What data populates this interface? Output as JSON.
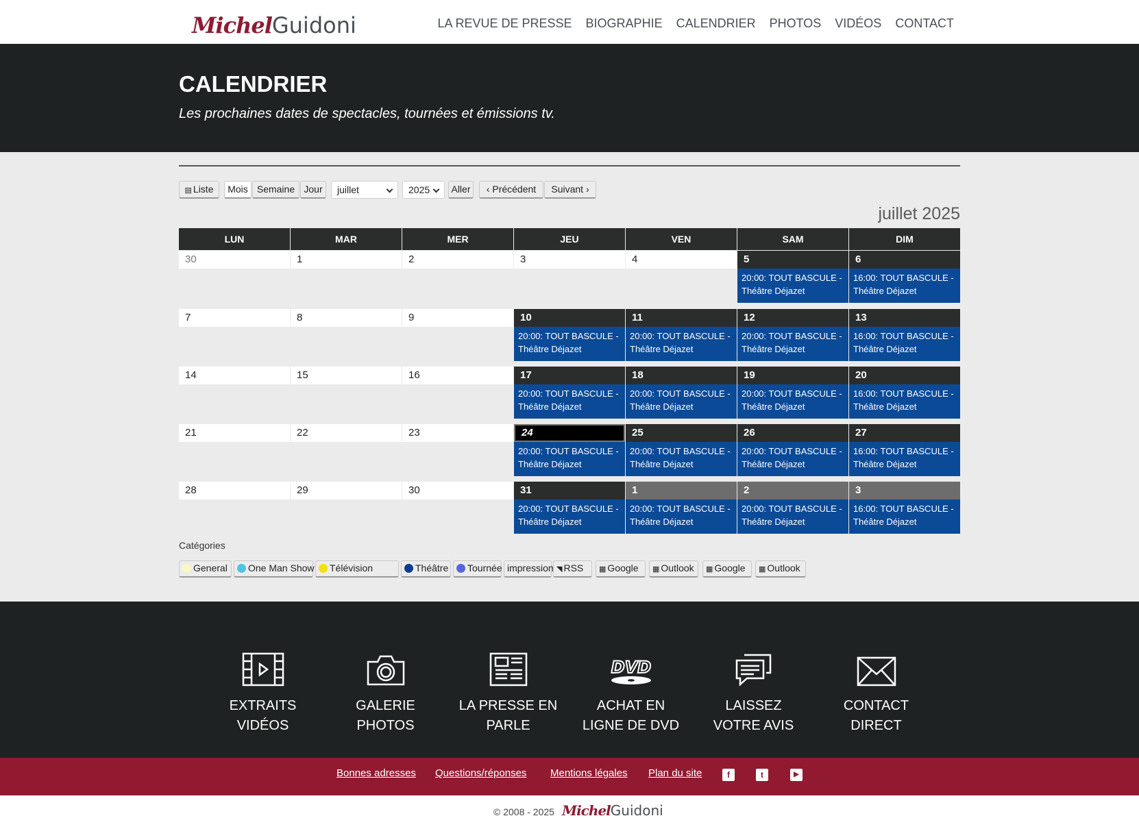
{
  "site": {
    "logo_first": "Michel",
    "logo_last": "Guidoni"
  },
  "nav": [
    "LA REVUE DE PRESSE",
    "BIOGRAPHIE",
    "CALENDRIER",
    "PHOTOS",
    "VIDÉOS",
    "CONTACT"
  ],
  "banner": {
    "title": "CALENDRIER",
    "subtitle": "Les prochaines dates de spectacles, tournées et émissions tv."
  },
  "toolbar": {
    "list": "Liste",
    "month": "Mois",
    "week": "Semaine",
    "day": "Jour",
    "month_select": "juillet",
    "year_select": "2025",
    "go": "Aller",
    "prev": "Précédent",
    "next": "Suivant"
  },
  "calendar": {
    "title": "juillet 2025",
    "weekdays": [
      "LUN",
      "MAR",
      "MER",
      "JEU",
      "VEN",
      "SAM",
      "DIM"
    ],
    "weeks": [
      [
        {
          "d": "30",
          "other": true
        },
        {
          "d": "1"
        },
        {
          "d": "2"
        },
        {
          "d": "3"
        },
        {
          "d": "4"
        },
        {
          "d": "5",
          "ev": "20:00: TOUT BASCULE - Théâtre Déjazet"
        },
        {
          "d": "6",
          "ev": "16:00: TOUT BASCULE - Théâtre Déjazet"
        }
      ],
      [
        {
          "d": "7"
        },
        {
          "d": "8"
        },
        {
          "d": "9"
        },
        {
          "d": "10",
          "ev": "20:00: TOUT BASCULE - Théâtre Déjazet"
        },
        {
          "d": "11",
          "ev": "20:00: TOUT BASCULE - Théâtre Déjazet"
        },
        {
          "d": "12",
          "ev": "20:00: TOUT BASCULE - Théâtre Déjazet"
        },
        {
          "d": "13",
          "ev": "16:00: TOUT BASCULE - Théâtre Déjazet"
        }
      ],
      [
        {
          "d": "14"
        },
        {
          "d": "15"
        },
        {
          "d": "16"
        },
        {
          "d": "17",
          "ev": "20:00: TOUT BASCULE - Théâtre Déjazet"
        },
        {
          "d": "18",
          "ev": "20:00: TOUT BASCULE - Théâtre Déjazet"
        },
        {
          "d": "19",
          "ev": "20:00: TOUT BASCULE - Théâtre Déjazet"
        },
        {
          "d": "20",
          "ev": "16:00: TOUT BASCULE - Théâtre Déjazet"
        }
      ],
      [
        {
          "d": "21"
        },
        {
          "d": "22"
        },
        {
          "d": "23"
        },
        {
          "d": "24",
          "today": true,
          "ev": "20:00: TOUT BASCULE - Théâtre Déjazet"
        },
        {
          "d": "25",
          "ev": "20:00: TOUT BASCULE - Théâtre Déjazet"
        },
        {
          "d": "26",
          "ev": "20:00: TOUT BASCULE - Théâtre Déjazet"
        },
        {
          "d": "27",
          "ev": "16:00: TOUT BASCULE - Théâtre Déjazet"
        }
      ],
      [
        {
          "d": "28"
        },
        {
          "d": "29"
        },
        {
          "d": "30"
        },
        {
          "d": "31",
          "ev": "20:00: TOUT BASCULE - Théâtre Déjazet"
        },
        {
          "d": "1",
          "next": true,
          "ev": "20:00: TOUT BASCULE - Théâtre Déjazet"
        },
        {
          "d": "2",
          "next": true,
          "ev": "20:00: TOUT BASCULE - Théâtre Déjazet"
        },
        {
          "d": "3",
          "next": true,
          "ev": "16:00: TOUT BASCULE - Théâtre Déjazet"
        }
      ]
    ]
  },
  "categories": {
    "label": "Catégories",
    "items": [
      {
        "label": "General",
        "color": "#fbf6c4"
      },
      {
        "label": "One Man Show",
        "color": "#4fc3e4"
      },
      {
        "label": "Télévision",
        "color": "#f2e20a"
      },
      {
        "label": "Théâtre",
        "color": "#0b3d8f"
      },
      {
        "label": "Tournée",
        "color": "#5566dd"
      },
      {
        "label": "impression"
      },
      {
        "label": "RSS",
        "icon": "rss-icon"
      },
      {
        "label": "Google",
        "icon": "calendar-icon"
      },
      {
        "label": "Outlook",
        "icon": "calendar-icon"
      },
      {
        "label": "Google",
        "icon": "calendar-icon"
      },
      {
        "label": "Outlook",
        "icon": "calendar-icon"
      }
    ]
  },
  "footer_links": [
    {
      "l1": "EXTRAITS",
      "l2": "VIDÉOS",
      "icon": "film-icon"
    },
    {
      "l1": "GALERIE",
      "l2": "PHOTOS",
      "icon": "camera-icon"
    },
    {
      "l1": "LA PRESSE EN",
      "l2": "PARLE",
      "icon": "newspaper-icon"
    },
    {
      "l1": "ACHAT EN",
      "l2": "LIGNE DE DVD",
      "icon": "dvd-icon"
    },
    {
      "l1": "LAISSEZ",
      "l2": "VOTRE AVIS",
      "icon": "chat-icon"
    },
    {
      "l1": "CONTACT",
      "l2": "DIRECT",
      "icon": "envelope-icon"
    }
  ],
  "bottom_links": [
    "Bonnes adresses",
    "Questions/réponses",
    "Mentions légales",
    "Plan du site"
  ],
  "social": [
    {
      "icon": "facebook-icon",
      "glyph": "f"
    },
    {
      "icon": "twitter-icon",
      "glyph": "t"
    },
    {
      "icon": "youtube-icon",
      "glyph": "▶"
    }
  ],
  "copyright": "© 2008 - 2025"
}
